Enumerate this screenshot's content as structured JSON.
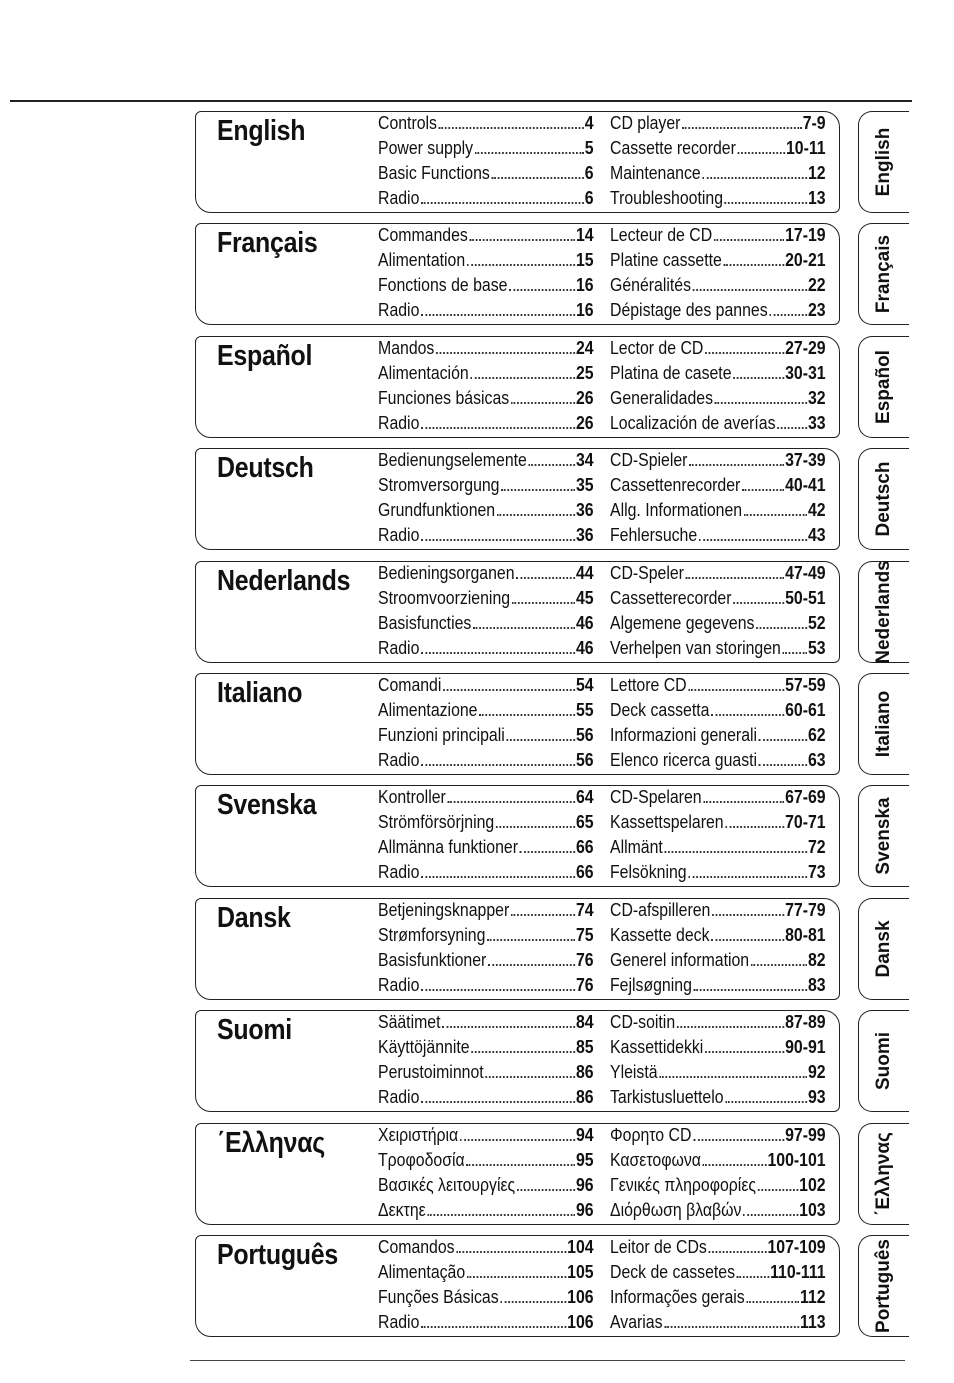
{
  "sections": [
    {
      "title": "English",
      "tab": "English",
      "col1": [
        {
          "label": "Controls",
          "page": "4"
        },
        {
          "label": "Power supply",
          "page": "5"
        },
        {
          "label": "Basic Functions",
          "page": "6"
        },
        {
          "label": "Radio",
          "page": "6"
        }
      ],
      "col2": [
        {
          "label": "CD player",
          "page": "7-9"
        },
        {
          "label": "Cassette recorder",
          "page": "10-11"
        },
        {
          "label": "Maintenance",
          "page": "12"
        },
        {
          "label": "Troubleshooting",
          "page": "13"
        }
      ]
    },
    {
      "title": "Français",
      "tab": "Français",
      "col1": [
        {
          "label": "Commandes",
          "page": "14"
        },
        {
          "label": "Alimentation",
          "page": "15"
        },
        {
          "label": "Fonctions de base",
          "page": "16"
        },
        {
          "label": "Radio",
          "page": "16"
        }
      ],
      "col2": [
        {
          "label": "Lecteur de CD",
          "page": "17-19"
        },
        {
          "label": "Platine cassette",
          "page": "20-21"
        },
        {
          "label": "Généralités",
          "page": "22"
        },
        {
          "label": "Dépistage des pannes",
          "page": "23"
        }
      ]
    },
    {
      "title": "Español",
      "tab": "Español",
      "col1": [
        {
          "label": "Mandos",
          "page": "24"
        },
        {
          "label": "Alimentación",
          "page": "25"
        },
        {
          "label": "Funciones básicas",
          "page": "26"
        },
        {
          "label": "Radio",
          "page": "26"
        }
      ],
      "col2": [
        {
          "label": "Lector de CD",
          "page": "27-29"
        },
        {
          "label": "Platina de casete",
          "page": "30-31"
        },
        {
          "label": "Generalidades",
          "page": "32"
        },
        {
          "label": "Localización de averías",
          "page": "33"
        }
      ]
    },
    {
      "title": "Deutsch",
      "tab": "Deutsch",
      "col1": [
        {
          "label": "Bedienungselemente",
          "page": "34"
        },
        {
          "label": "Stromversorgung",
          "page": "35"
        },
        {
          "label": "Grundfunktionen",
          "page": "36"
        },
        {
          "label": "Radio",
          "page": "36"
        }
      ],
      "col2": [
        {
          "label": "CD-Spieler",
          "page": "37-39"
        },
        {
          "label": "Cassettenrecorder",
          "page": "40-41"
        },
        {
          "label": "Allg. Informationen",
          "page": "42"
        },
        {
          "label": "Fehlersuche",
          "page": "43"
        }
      ]
    },
    {
      "title": "Nederlands",
      "tab": "Nederlands",
      "col1": [
        {
          "label": "Bedieningsorganen",
          "page": "44"
        },
        {
          "label": "Stroomvoorziening",
          "page": "45"
        },
        {
          "label": "Basisfuncties",
          "page": "46"
        },
        {
          "label": "Radio",
          "page": "46"
        }
      ],
      "col2": [
        {
          "label": "CD-Speler",
          "page": "47-49"
        },
        {
          "label": "Cassetterecorder",
          "page": "50-51"
        },
        {
          "label": "Algemene gegevens",
          "page": "52"
        },
        {
          "label": "Verhelpen van storingen",
          "page": "53"
        }
      ]
    },
    {
      "title": "Italiano",
      "tab": "Italiano",
      "col1": [
        {
          "label": "Comandi",
          "page": "54"
        },
        {
          "label": "Alimentazione",
          "page": "55"
        },
        {
          "label": "Funzioni principali",
          "page": "56"
        },
        {
          "label": "Radio",
          "page": "56"
        }
      ],
      "col2": [
        {
          "label": "Lettore CD",
          "page": "57-59"
        },
        {
          "label": "Deck cassetta",
          "page": "60-61"
        },
        {
          "label": "Informazioni generali",
          "page": "62"
        },
        {
          "label": "Elenco ricerca guasti",
          "page": "63"
        }
      ]
    },
    {
      "title": "Svenska",
      "tab": "Svenska",
      "col1": [
        {
          "label": "Kontroller",
          "page": "64"
        },
        {
          "label": "Strömförsörjning",
          "page": "65"
        },
        {
          "label": "Allmänna funktioner",
          "page": "66"
        },
        {
          "label": "Radio",
          "page": "66"
        }
      ],
      "col2": [
        {
          "label": "CD-Spelaren",
          "page": "67-69"
        },
        {
          "label": "Kassettspelaren",
          "page": "70-71"
        },
        {
          "label": "Allmänt",
          "page": "72"
        },
        {
          "label": "Felsökning",
          "page": "73"
        }
      ]
    },
    {
      "title": "Dansk",
      "tab": "Dansk",
      "col1": [
        {
          "label": "Betjeningsknapper",
          "page": "74"
        },
        {
          "label": "Strømforsyning",
          "page": "75"
        },
        {
          "label": "Basisfunktioner",
          "page": "76"
        },
        {
          "label": "Radio",
          "page": "76"
        }
      ],
      "col2": [
        {
          "label": "CD-afspilleren",
          "page": "77-79"
        },
        {
          "label": "Kassette deck",
          "page": "80-81"
        },
        {
          "label": "Generel information",
          "page": "82"
        },
        {
          "label": "Fejlsøgning",
          "page": "83"
        }
      ]
    },
    {
      "title": "Suomi",
      "tab": "Suomi",
      "col1": [
        {
          "label": "Säätimet",
          "page": "84"
        },
        {
          "label": "Käyttöjännite",
          "page": "85"
        },
        {
          "label": "Perustoiminnot",
          "page": "86"
        },
        {
          "label": "Radio",
          "page": "86"
        }
      ],
      "col2": [
        {
          "label": "CD-soitin",
          "page": "87-89"
        },
        {
          "label": "Kassettidekki",
          "page": "90-91"
        },
        {
          "label": "Yleistä",
          "page": "92"
        },
        {
          "label": "Tarkistusluettelo",
          "page": "93"
        }
      ]
    },
    {
      "title": "΄Ελληνας",
      "tab": "΄Ελληνας",
      "col1": [
        {
          "label": "Χειριστήρια",
          "page": "94"
        },
        {
          "label": "Τροφοδοσία",
          "page": "95"
        },
        {
          "label": "Βασικές λειτουργίες",
          "page": "96"
        },
        {
          "label": "Δεκτηε",
          "page": "96"
        }
      ],
      "col2": [
        {
          "label": "Φορητο CD",
          "page": "97-99"
        },
        {
          "label": "Κασετοφωνα",
          "page": "100-101"
        },
        {
          "label": "Γενικές πληροφορίες",
          "page": "102"
        },
        {
          "label": "Διόρθωση βλαβών",
          "page": "103"
        }
      ]
    },
    {
      "title": "Português",
      "tab": "Português",
      "col1": [
        {
          "label": "Comandos",
          "page": "104"
        },
        {
          "label": "Alimentação",
          "page": "105"
        },
        {
          "label": "Funções Básicas",
          "page": "106"
        },
        {
          "label": "Radio",
          "page": "106"
        }
      ],
      "col2": [
        {
          "label": "Leitor de CDs",
          "page": "107-109"
        },
        {
          "label": "Deck de cassetes",
          "page": "110-111"
        },
        {
          "label": "Informações gerais",
          "page": "112"
        },
        {
          "label": "Avarias",
          "page": "113"
        }
      ]
    }
  ]
}
